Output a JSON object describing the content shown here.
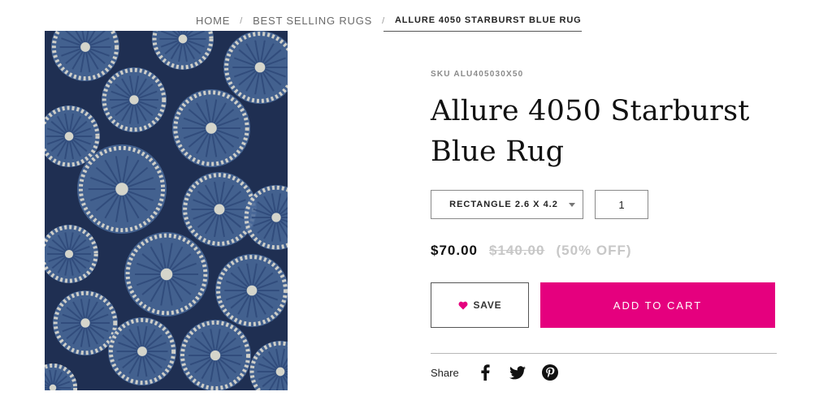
{
  "breadcrumb": {
    "items": [
      {
        "label": "HOME"
      },
      {
        "label": "BEST SELLING RUGS"
      }
    ],
    "separator": "/",
    "current": "ALLURE 4050 STARBURST BLUE RUG"
  },
  "product": {
    "sku": "SKU ALU405030X50",
    "title": "Allure 4050 Starburst Blue Rug",
    "image_icon": "rug-image",
    "colors": {
      "rug_base": "#1f2f52",
      "rug_blue": "#4a6a9a",
      "rug_cream": "#e6e2d2"
    }
  },
  "options": {
    "size_selected": "RECTANGLE 2.6 X 4.2",
    "quantity": "1"
  },
  "pricing": {
    "current": "$70.00",
    "original": "$140.00",
    "discount": "(50% OFF)"
  },
  "actions": {
    "save_label": "SAVE",
    "cart_label": "ADD TO CART",
    "accent_color": "#e5007e"
  },
  "share": {
    "label": "Share",
    "networks": [
      "facebook-icon",
      "twitter-icon",
      "pinterest-icon"
    ]
  }
}
